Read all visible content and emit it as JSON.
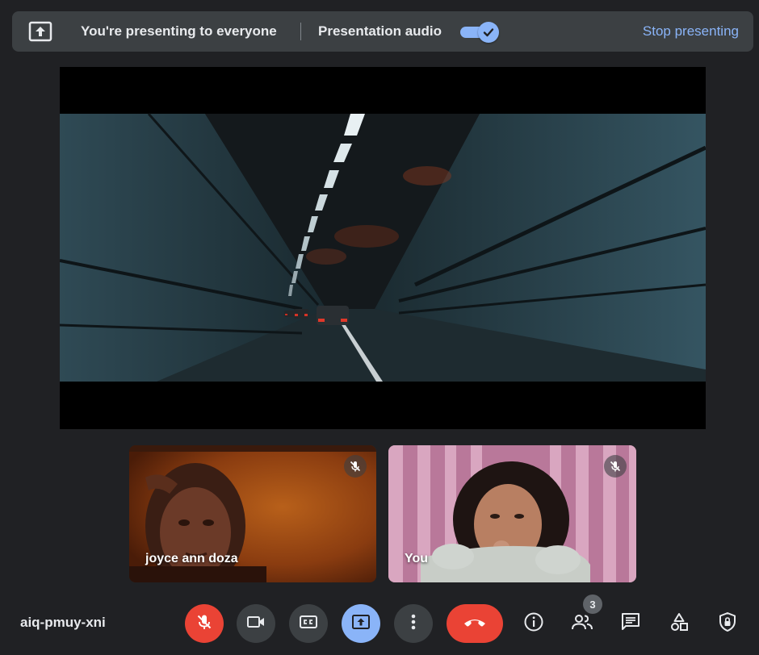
{
  "banner": {
    "presenting_text": "You're presenting to everyone",
    "audio_label": "Presentation audio",
    "audio_enabled": true,
    "stop_label": "Stop presenting"
  },
  "presentation": {
    "content": "video-tunnel-scene"
  },
  "participants": [
    {
      "name": "joyce ann doza",
      "muted": true
    },
    {
      "name": "You",
      "muted": true
    }
  ],
  "footer": {
    "meeting_code": "aiq-pmuy-xni",
    "controls": {
      "mic": "mic-off-icon",
      "camera": "videocam-icon",
      "captions": "closed-caption-icon",
      "present": "present-to-all-icon",
      "more": "more-vert-icon",
      "leave": "call-end-icon"
    },
    "side": {
      "info": "info-icon",
      "people": "people-icon",
      "people_count": "3",
      "chat": "chat-icon",
      "activities": "activities-icon",
      "host_controls": "shield-lock-icon"
    }
  },
  "colors": {
    "background": "#202124",
    "surface": "#3c4043",
    "accent": "#8ab4f8",
    "danger": "#ea4335"
  }
}
